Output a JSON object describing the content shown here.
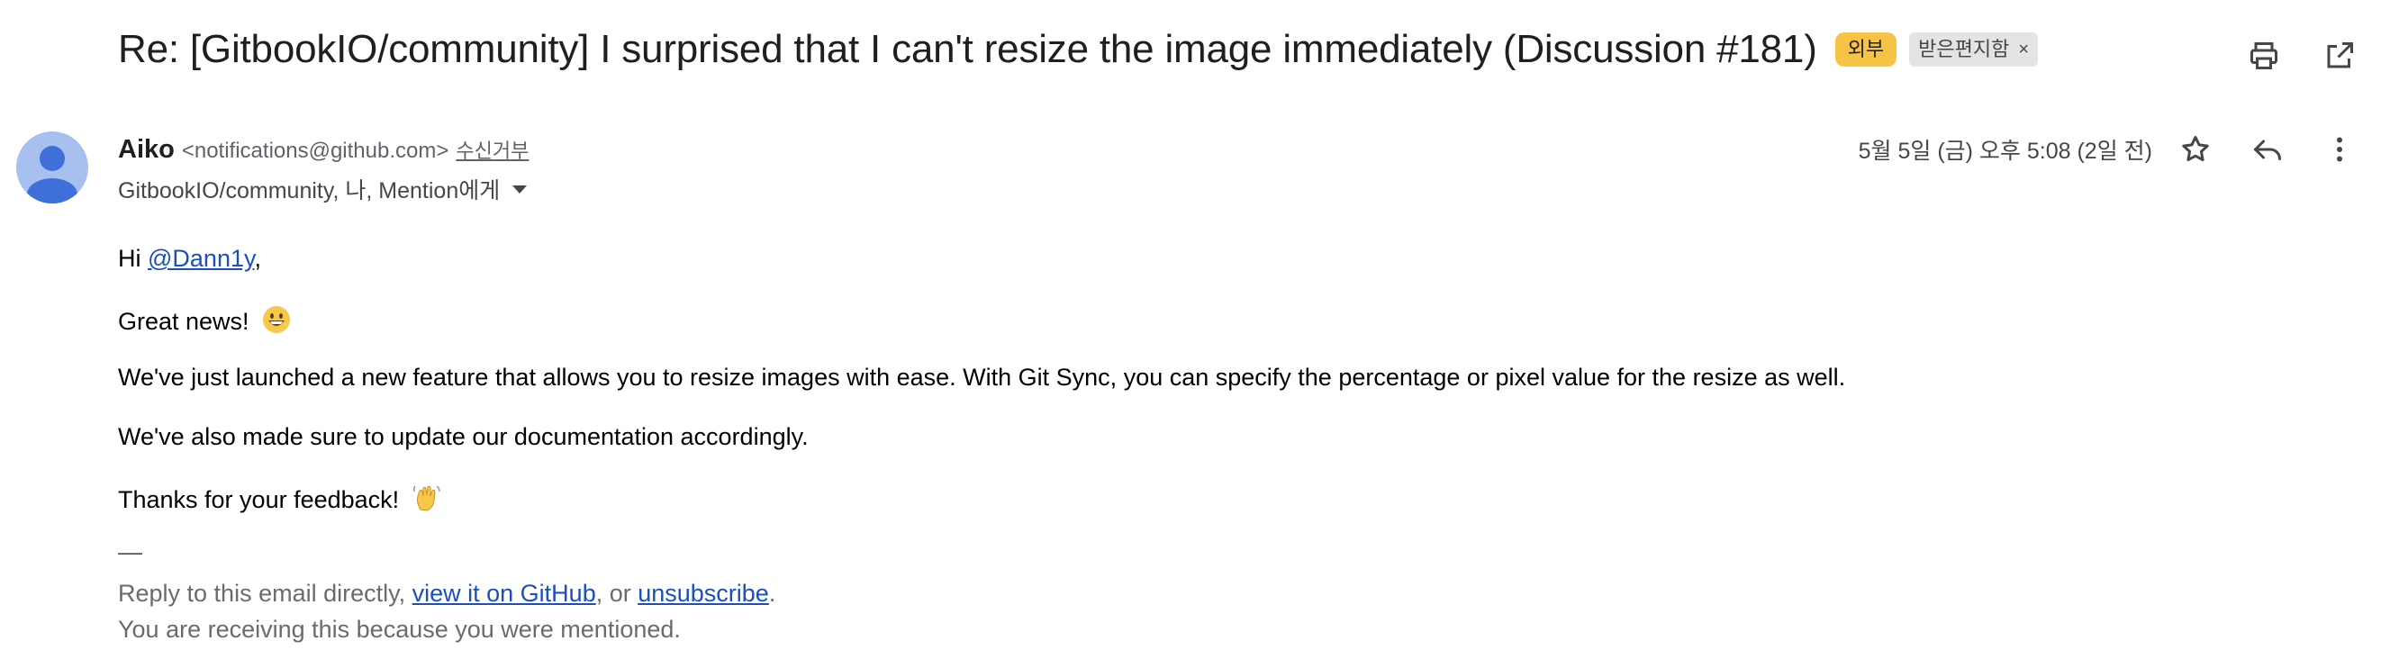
{
  "email": {
    "subject": "Re: [GitbookIO/community] I surprised that I can't resize the image immediately (Discussion #181)",
    "badges": {
      "external": "외부",
      "inbox": "받은편지함",
      "inbox_close": "×"
    },
    "sender": {
      "name": "Aiko",
      "email": "<notifications@github.com>",
      "unsubscribe": "수신거부"
    },
    "recipients": "GitbookIO/community, 나, Mention에게",
    "date": "5월 5일 (금) 오후 5:08 (2일 전)",
    "body": {
      "greeting_prefix": "Hi ",
      "mention": "@Dann1y",
      "greeting_suffix": ",",
      "line1": "Great news!",
      "line2": "We've just launched a new feature that allows you to resize images with ease. With Git Sync, you can specify the percentage or pixel value for the resize as well.",
      "line3": "We've also made sure to update our documentation accordingly.",
      "line4": "Thanks for your feedback!"
    },
    "footer": {
      "dash": "—",
      "reply_prefix": "Reply to this email directly, ",
      "view_link": "view it on GitHub",
      "or_text": ", or ",
      "unsubscribe_link": "unsubscribe",
      "period": ".",
      "reason": "You are receiving this because you were mentioned."
    }
  },
  "icons": [
    "print-icon",
    "open-in-new-window-icon",
    "star-icon",
    "reply-icon",
    "more-vert-icon",
    "avatar-person-icon",
    "grinning-face-emoji",
    "waving-hand-emoji"
  ],
  "colors": {
    "external_badge": "#f6c344",
    "inbox_badge": "#e4e4e4",
    "link": "#1a4fc0",
    "avatar": "#a8c0f0"
  }
}
